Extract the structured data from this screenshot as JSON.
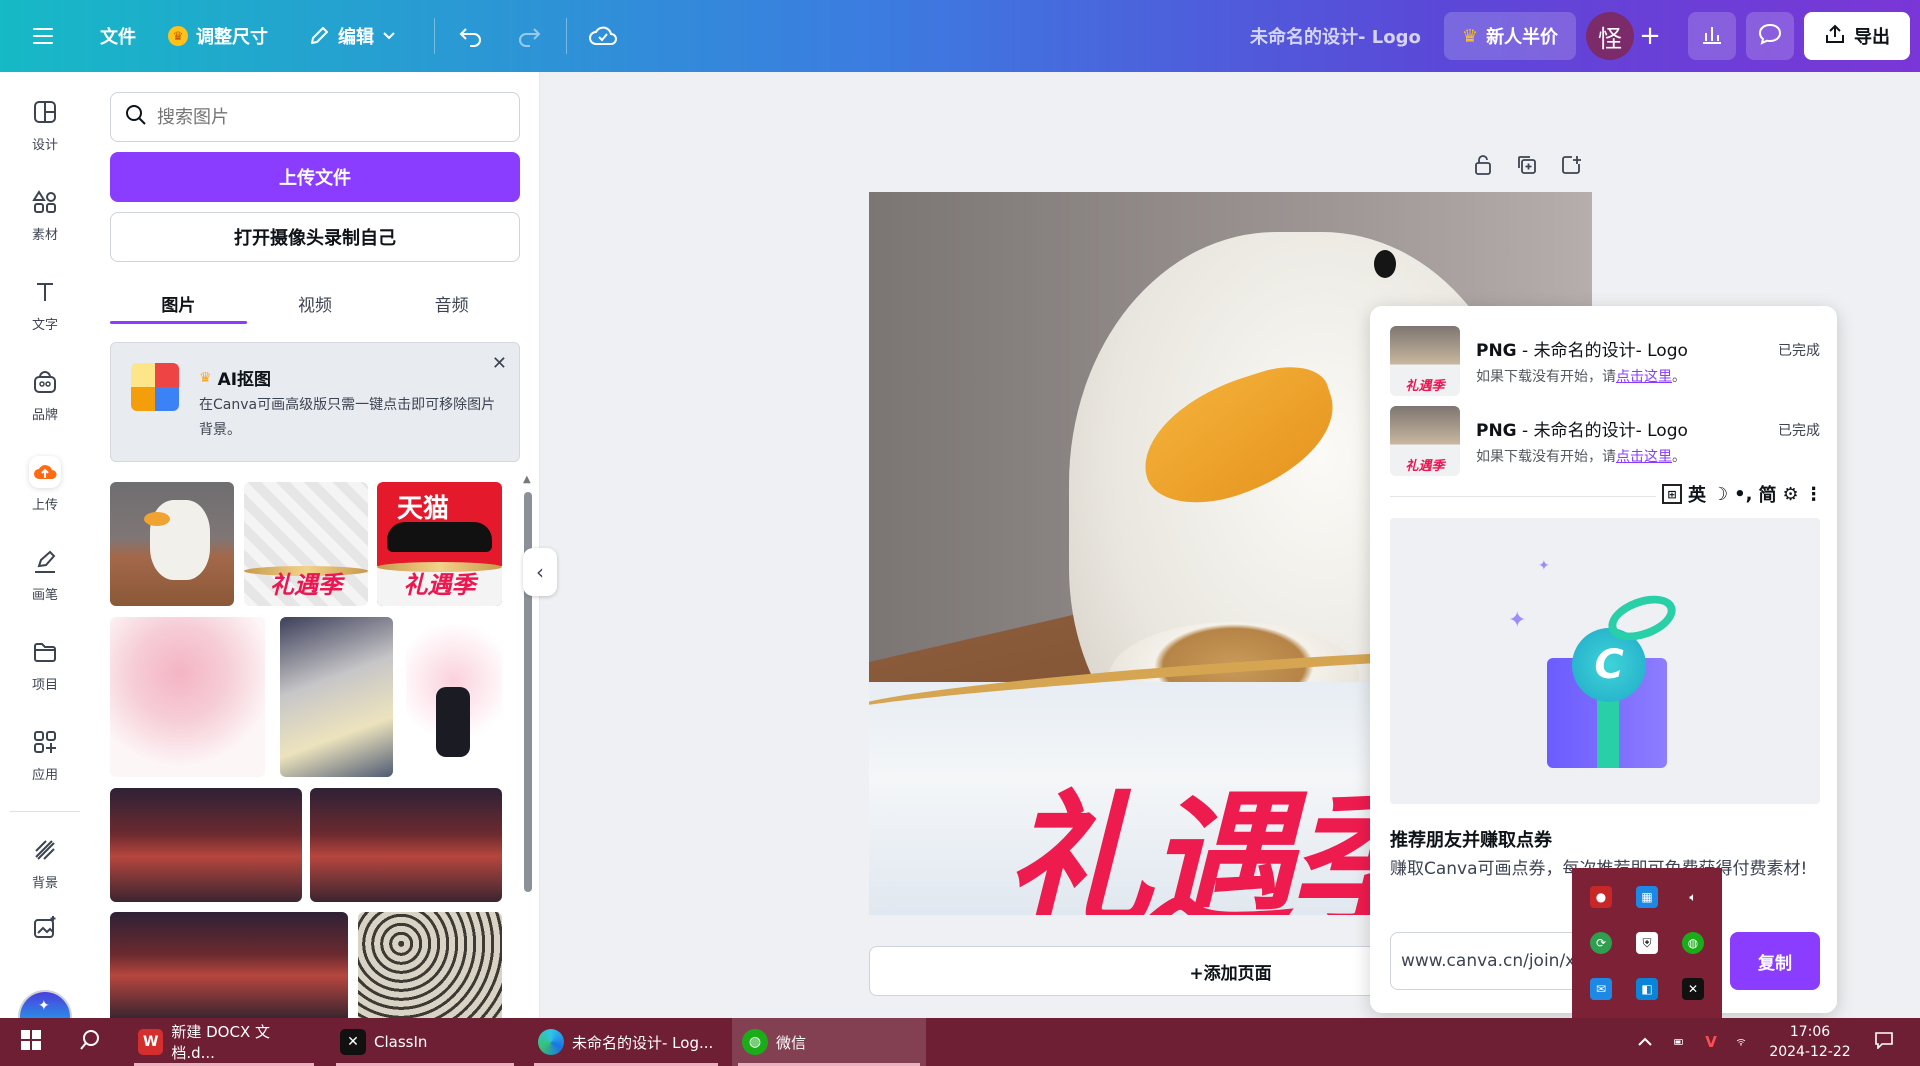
{
  "topbar": {
    "file": "文件",
    "resize": "调整尺寸",
    "edit": "编辑",
    "title": "未命名的设计- Logo",
    "promo": "新人半价",
    "avatar_letter": "怪",
    "export": "导出"
  },
  "leftnav": {
    "items": [
      {
        "label": "设计",
        "icon": "layout-icon"
      },
      {
        "label": "素材",
        "icon": "shapes-icon"
      },
      {
        "label": "文字",
        "icon": "text-icon"
      },
      {
        "label": "品牌",
        "icon": "brand-icon"
      },
      {
        "label": "上传",
        "icon": "upload-cloud-icon"
      },
      {
        "label": "画笔",
        "icon": "draw-icon"
      },
      {
        "label": "项目",
        "icon": "folder-icon"
      },
      {
        "label": "应用",
        "icon": "apps-icon"
      },
      {
        "label": "背景",
        "icon": "background-icon"
      }
    ]
  },
  "panel": {
    "search_placeholder": "搜索图片",
    "upload_button": "上传文件",
    "camera_button": "打开摄像头录制自己",
    "tabs": [
      "图片",
      "视频",
      "音频"
    ],
    "active_tab": "图片",
    "ai_card": {
      "title": "AI抠图",
      "desc": "在Canva可画高级版只需一键点击即可移除图片背景。"
    },
    "thumb_labels": {
      "lijiji": "礼遇季",
      "tmall": "天猫"
    }
  },
  "canvas": {
    "design_text": "礼遇季",
    "add_page": "+添加页面"
  },
  "downloads": [
    {
      "type": "PNG",
      "name": " - 未命名的设计- Logo",
      "sub": "如果下载没有开始，请",
      "link": "点击这里",
      "tail": "。",
      "status": "已完成"
    },
    {
      "type": "PNG",
      "name": " - 未命名的设计- Logo",
      "sub": "如果下载没有开始，请",
      "link": "点击这里",
      "tail": "。",
      "status": "已完成"
    }
  ],
  "referral": {
    "title": "推荐朋友并赚取点券",
    "desc": "赚取Canva可画点券，每次推荐即可免费获得付费素材!",
    "url": "www.canva.cn/join/x",
    "copy": "复制"
  },
  "ime": {
    "mode": "英",
    "script": "简"
  },
  "taskbar": {
    "items": [
      {
        "label": "新建 DOCX 文档.d..."
      },
      {
        "label": "ClassIn"
      },
      {
        "label": "未命名的设计- Log..."
      },
      {
        "label": "微信"
      }
    ],
    "time": "17:06",
    "date": "2024-12-22"
  },
  "colors": {
    "accent": "#8b3dff",
    "taskbar": "#6e1f34",
    "brand_red": "#ee1b4e"
  }
}
